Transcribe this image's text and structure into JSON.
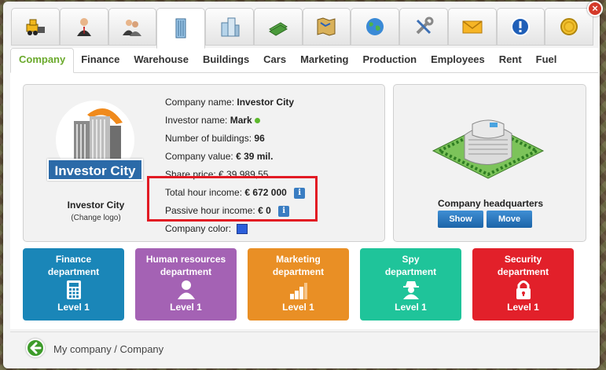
{
  "window": {
    "close_label": "×"
  },
  "icon_tabs": [
    {
      "icon": "bulldozer-icon"
    },
    {
      "icon": "businessman-icon"
    },
    {
      "icon": "people-icon"
    },
    {
      "icon": "office-building-icon"
    },
    {
      "icon": "buildings-icon"
    },
    {
      "icon": "money-stack-icon"
    },
    {
      "icon": "map-icon"
    },
    {
      "icon": "globe-icon"
    },
    {
      "icon": "tools-icon"
    },
    {
      "icon": "envelope-icon"
    },
    {
      "icon": "exclamation-icon"
    },
    {
      "icon": "coin-icon"
    }
  ],
  "tabs": [
    "Company",
    "Finance",
    "Warehouse",
    "Buildings",
    "Cars",
    "Marketing",
    "Production",
    "Employees",
    "Rent",
    "Fuel"
  ],
  "company": {
    "logo_text": "Investor City",
    "name_caption": "Investor City",
    "change_logo": "(Change logo)",
    "name_label": "Company name:",
    "name_value": "Investor City",
    "investor_label": "Investor name:",
    "investor_value": "Mark",
    "buildings_label": "Number of buildings:",
    "buildings_value": "96",
    "value_label": "Company value:",
    "value_value": "€ 39 mil.",
    "share_label": "Share price:",
    "share_value": "€ 39 989,55",
    "total_income_label": "Total hour income:",
    "total_income_value": "€ 672 000",
    "passive_income_label": "Passive hour income:",
    "passive_income_value": "€ 0",
    "color_label": "Company color:",
    "color": "#2c5fdb",
    "info_glyph": "i"
  },
  "headquarters": {
    "caption": "Company headquarters",
    "show_label": "Show",
    "move_label": "Move"
  },
  "departments": [
    {
      "line1": "Finance",
      "line2": "department",
      "level": "Level 1",
      "color": "#1a86b8",
      "icon": "calculator-icon"
    },
    {
      "line1": "Human resources",
      "line2": "department",
      "level": "Level 1",
      "color": "#a462b4",
      "icon": "person-icon"
    },
    {
      "line1": "Marketing",
      "line2": "department",
      "level": "Level 1",
      "color": "#e98f25",
      "icon": "signal-bars-icon"
    },
    {
      "line1": "Spy",
      "line2": "department",
      "level": "Level 1",
      "color": "#1fc49a",
      "icon": "spy-icon"
    },
    {
      "line1": "Security",
      "line2": "department",
      "level": "Level 1",
      "color": "#e2202a",
      "icon": "lock-icon"
    }
  ],
  "footer": {
    "breadcrumb": "My company / Company"
  }
}
